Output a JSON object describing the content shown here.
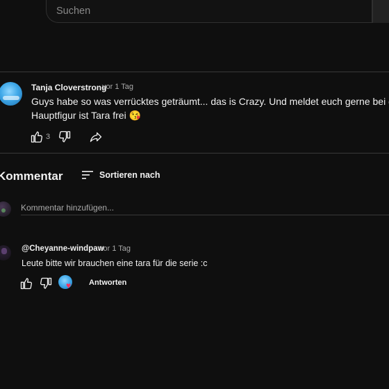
{
  "search": {
    "placeholder": "Suchen"
  },
  "post": {
    "author": "Tanja Cloverstrong",
    "time": "vor 1 Tag",
    "line1": "Guys habe so was verrücktes geträumt... das  is Crazy. Und meldet euch gerne bei d",
    "line2": "Hauptfigur ist Tara frei",
    "emoji": "😘",
    "like_count": "3"
  },
  "comments_section": {
    "title": "Kommentar",
    "sort_label": "Sortieren nach",
    "add_placeholder": "Kommentar hinzufügen..."
  },
  "comments": [
    {
      "author": "@Cheyanne-windpaw",
      "time": "vor 1 Tag",
      "text": "Leute bitte wir brauchen eine tara für die serie :c",
      "reply_label": "Antworten"
    }
  ],
  "colors": {
    "background": "#0f0f0f",
    "text": "#f1f1f1",
    "secondary": "#aaaaaa",
    "heart": "#ff2e5a"
  },
  "icons": [
    "thumbs-up-icon",
    "thumbs-down-icon",
    "share-icon",
    "sort-icon",
    "heart-icon"
  ]
}
